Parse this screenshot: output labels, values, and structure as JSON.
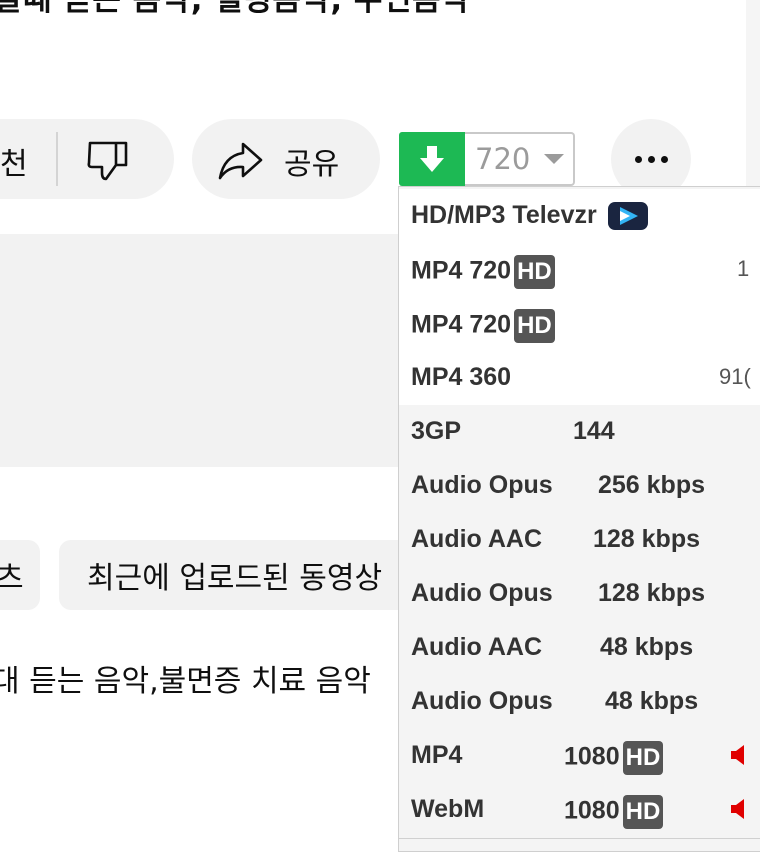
{
  "video": {
    "title": "잘때 듣는 음악, 힐링음악, 수면음악"
  },
  "actions": {
    "like_label": "천",
    "share_label": "공유"
  },
  "download": {
    "quality": "720",
    "accent_color": "#1db954"
  },
  "chips": [
    "츠",
    "최근에 업로드된 동영상"
  ],
  "description": "대 듣는 음악,불면증 치료 음악",
  "menu": {
    "items": [
      {
        "format": "HD/MP3 Televzr",
        "quality": "",
        "hd": false,
        "size": "",
        "icon": "televzr-icon"
      },
      {
        "format": "MP4 720",
        "quality": "",
        "hd": true,
        "size": "1",
        "icon": ""
      },
      {
        "format": "MP4 720",
        "quality": "",
        "hd": true,
        "size": "",
        "icon": ""
      },
      {
        "format": "MP4 360",
        "quality": "",
        "hd": false,
        "size": "91(",
        "icon": ""
      },
      {
        "format": "3GP",
        "quality": "144",
        "hd": false,
        "size": "",
        "icon": ""
      },
      {
        "format": "Audio Opus",
        "quality": "256 kbps",
        "hd": false,
        "size": "",
        "icon": ""
      },
      {
        "format": "Audio AAC",
        "quality": "128 kbps",
        "hd": false,
        "size": "",
        "icon": ""
      },
      {
        "format": "Audio Opus",
        "quality": "128 kbps",
        "hd": false,
        "size": "",
        "icon": ""
      },
      {
        "format": "Audio AAC",
        "quality": "48 kbps",
        "hd": false,
        "size": "",
        "icon": ""
      },
      {
        "format": "Audio Opus",
        "quality": "48 kbps",
        "hd": false,
        "size": "",
        "icon": ""
      },
      {
        "format": "MP4",
        "quality": "1080",
        "hd": true,
        "size": "",
        "icon": "mute-icon"
      },
      {
        "format": "WebM",
        "quality": "1080",
        "hd": true,
        "size": "",
        "icon": "mute-icon"
      }
    ],
    "hd_label": "HD"
  }
}
